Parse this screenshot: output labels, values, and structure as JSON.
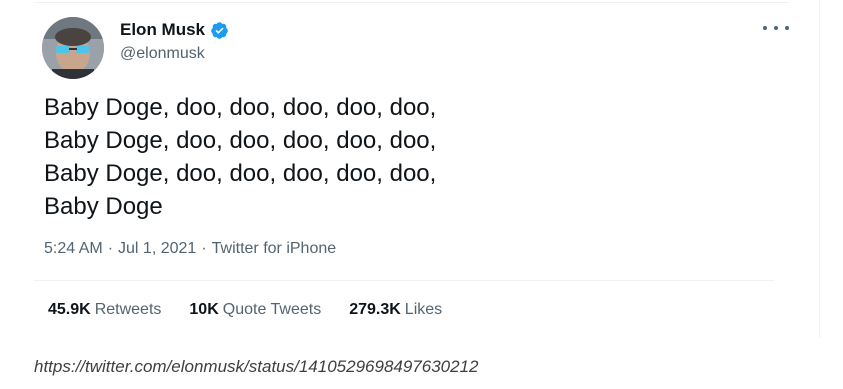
{
  "author": {
    "name": "Elon Musk",
    "handle": "@elonmusk",
    "verified": true
  },
  "tweet": {
    "lines": [
      "Baby Doge, doo, doo, doo, doo, doo,",
      "Baby Doge, doo, doo, doo, doo, doo,",
      "Baby Doge, doo, doo, doo, doo, doo,",
      "Baby Doge"
    ],
    "time": "5:24 AM",
    "date": "Jul 1, 2021",
    "source": "Twitter for iPhone",
    "separator": "·"
  },
  "stats": [
    {
      "count": "45.9K",
      "label": "Retweets"
    },
    {
      "count": "10K",
      "label": "Quote Tweets"
    },
    {
      "count": "279.3K",
      "label": "Likes"
    }
  ],
  "caption_url": "https://twitter.com/elonmusk/status/1410529698497630212",
  "colors": {
    "text": "#0f1419",
    "secondary": "#536471",
    "verified": "#1d9bf0",
    "divider": "#eff3f4"
  },
  "icons": {
    "verified": "verified-badge-icon",
    "more": "more-options-icon"
  }
}
